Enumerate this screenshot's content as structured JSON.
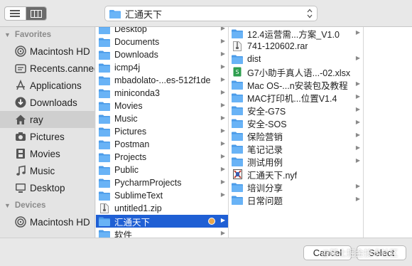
{
  "toolbar": {
    "path_label": "汇通天下"
  },
  "sidebar": {
    "favorites_heading": "Favorites",
    "favorites": [
      {
        "label": "Macintosh HD",
        "icon": "harddisk-icon"
      },
      {
        "label": "Recents.cannedSearch",
        "icon": "recents-icon"
      },
      {
        "label": "Applications",
        "icon": "applications-icon"
      },
      {
        "label": "Downloads",
        "icon": "downloads-icon"
      },
      {
        "label": "ray",
        "icon": "home-icon",
        "selected": true
      },
      {
        "label": "Pictures",
        "icon": "camera-icon"
      },
      {
        "label": "Movies",
        "icon": "film-icon"
      },
      {
        "label": "Music",
        "icon": "music-icon"
      },
      {
        "label": "Desktop",
        "icon": "desktop-icon"
      }
    ],
    "devices_heading": "Devices",
    "devices": [
      {
        "label": "Macintosh HD",
        "icon": "harddisk-icon"
      }
    ]
  },
  "column1": [
    {
      "label": "Desktop",
      "kind": "folder",
      "chevron": true
    },
    {
      "label": "Documents",
      "kind": "folder",
      "chevron": true
    },
    {
      "label": "Downloads",
      "kind": "folder",
      "chevron": true
    },
    {
      "label": "icmp4j",
      "kind": "folder",
      "chevron": true
    },
    {
      "label": "mbadolato-...es-512f1de",
      "kind": "folder",
      "chevron": true
    },
    {
      "label": "miniconda3",
      "kind": "folder",
      "chevron": true
    },
    {
      "label": "Movies",
      "kind": "folder",
      "chevron": true
    },
    {
      "label": "Music",
      "kind": "folder",
      "chevron": true
    },
    {
      "label": "Pictures",
      "kind": "folder",
      "chevron": true
    },
    {
      "label": "Postman",
      "kind": "folder",
      "chevron": true
    },
    {
      "label": "Projects",
      "kind": "folder",
      "chevron": true
    },
    {
      "label": "Public",
      "kind": "folder",
      "chevron": true
    },
    {
      "label": "PycharmProjects",
      "kind": "folder",
      "chevron": true
    },
    {
      "label": "SublimeText",
      "kind": "folder",
      "chevron": true
    },
    {
      "label": "untitled1.zip",
      "kind": "zip",
      "chevron": false
    },
    {
      "label": "汇通天下",
      "kind": "folder",
      "chevron": true,
      "selected": true,
      "tag_color": "#e8a64a"
    },
    {
      "label": "软件",
      "kind": "folder",
      "chevron": true
    }
  ],
  "column2": [
    {
      "label": "12.4运营需...方案_V1.0",
      "kind": "folder",
      "chevron": true
    },
    {
      "label": "741-120602.rar",
      "kind": "rar",
      "chevron": false
    },
    {
      "label": "dist",
      "kind": "folder",
      "chevron": true
    },
    {
      "label": "G7小助手真人语...-02.xlsx",
      "kind": "xlsx",
      "chevron": false
    },
    {
      "label": "Mac OS-...n安装包及教程",
      "kind": "folder",
      "chevron": true
    },
    {
      "label": "MAC打印机...位置V1.4",
      "kind": "folder",
      "chevron": true
    },
    {
      "label": "安全-G7S",
      "kind": "folder",
      "chevron": true
    },
    {
      "label": "安全-SOS",
      "kind": "folder",
      "chevron": true
    },
    {
      "label": "保险营销",
      "kind": "folder",
      "chevron": true
    },
    {
      "label": "笔记记录",
      "kind": "folder",
      "chevron": true
    },
    {
      "label": "测试用例",
      "kind": "folder",
      "chevron": true
    },
    {
      "label": "汇通天下.nyf",
      "kind": "nyf",
      "chevron": false
    },
    {
      "label": "培训分享",
      "kind": "folder",
      "chevron": true
    },
    {
      "label": "日常问题",
      "kind": "folder",
      "chevron": true
    }
  ],
  "buttons": {
    "cancel": "Cancel",
    "select": "Select"
  },
  "watermark": "@稀土掘金技术社区",
  "colors": {
    "selection": "#1f5fd4",
    "folder": "#5aa9f3",
    "tag": "#e8a64a"
  }
}
